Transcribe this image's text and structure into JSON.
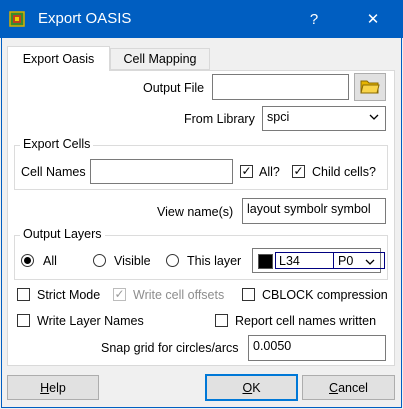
{
  "window": {
    "title": "Export OASIS",
    "help_glyph": "?",
    "close_glyph": "✕"
  },
  "tabs": [
    {
      "label": "Export Oasis",
      "active": true
    },
    {
      "label": "Cell Mapping",
      "active": false
    }
  ],
  "output_file": {
    "label": "Output File",
    "value": ""
  },
  "from_library": {
    "label": "From Library",
    "value": "spci"
  },
  "export_cells": {
    "group_title": "Export Cells",
    "cell_names_label": "Cell Names",
    "cell_names_value": "",
    "all_label": "All?",
    "all_checked": true,
    "child_label": "Child cells?",
    "child_checked": true
  },
  "view_names": {
    "label": "View name(s)",
    "value": "layout symbolr symbol"
  },
  "output_layers": {
    "group_title": "Output Layers",
    "radio_all": "All",
    "radio_visible": "Visible",
    "radio_this": "This layer",
    "selected": "All",
    "layer_name": "L34",
    "layer_purpose": "P0",
    "layer_color": "#000000"
  },
  "options": {
    "strict_mode": {
      "label": "Strict Mode",
      "checked": false
    },
    "write_cell_offsets": {
      "label": "Write cell offsets",
      "checked": true,
      "disabled": true
    },
    "cblock": {
      "label": "CBLOCK compression",
      "checked": false
    },
    "write_layer_names": {
      "label": "Write Layer Names",
      "checked": false
    },
    "report_cell_names": {
      "label": "Report cell names written",
      "checked": false
    }
  },
  "snap_grid": {
    "label": "Snap grid for circles/arcs",
    "value": "0.0050"
  },
  "buttons": {
    "help": {
      "label_ul": "H",
      "label_rest": "elp"
    },
    "ok": {
      "label_ul": "O",
      "label_rest": "K"
    },
    "cancel": {
      "label_ul": "C",
      "label_rest": "ancel"
    }
  },
  "colors": {
    "titlebar": "#005ec1",
    "accent": "#0078d7",
    "background": "#f0f0f0"
  }
}
